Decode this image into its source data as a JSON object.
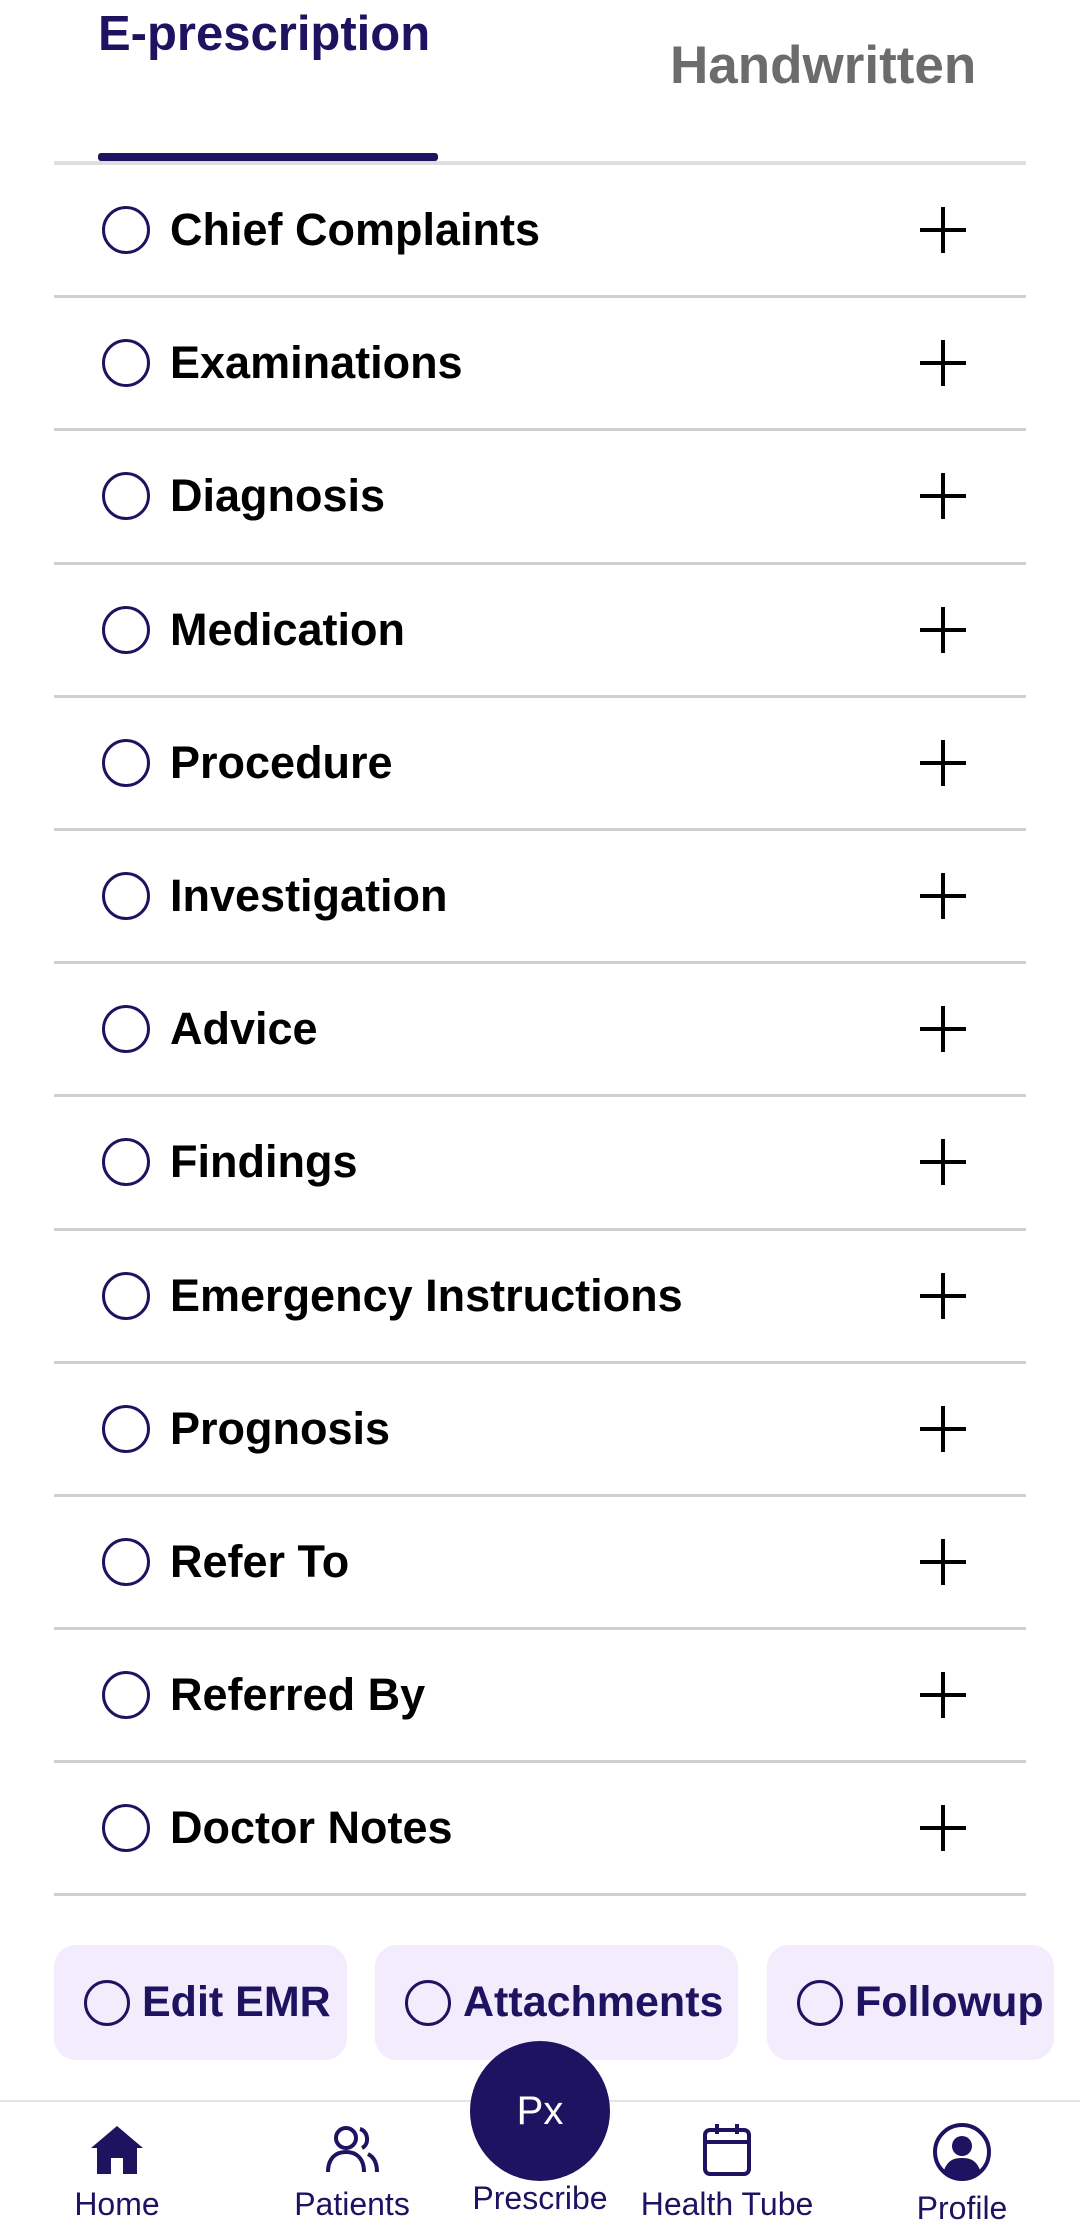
{
  "tabs": {
    "eprescription": "E-prescription",
    "handwritten": "Handwritten"
  },
  "sections": [
    "Chief Complaints",
    "Examinations",
    "Diagnosis",
    "Medication",
    "Procedure",
    "Investigation",
    "Advice",
    "Findings",
    "Emergency Instructions",
    "Prognosis",
    "Refer To",
    "Referred By",
    "Doctor Notes"
  ],
  "actions": {
    "edit_emr": "Edit EMR",
    "attachments": "Attachments",
    "followup": "Followup"
  },
  "fab": {
    "label": "Px"
  },
  "nav": {
    "home": "Home",
    "patients": "Patients",
    "prescribe": "Prescribe",
    "health_tube": "Health Tube",
    "profile": "Profile"
  },
  "colors": {
    "primary": "#1e1360",
    "chip_bg": "#f3ecfc",
    "divider": "#cfcfcf",
    "inactive_tab": "#6c6c6c"
  },
  "icons": {
    "home": "home-icon",
    "patients": "users-icon",
    "health_tube": "calendar-icon",
    "profile": "user-circle-icon",
    "row_add": "plus-icon",
    "row_radio": "radio-icon"
  }
}
